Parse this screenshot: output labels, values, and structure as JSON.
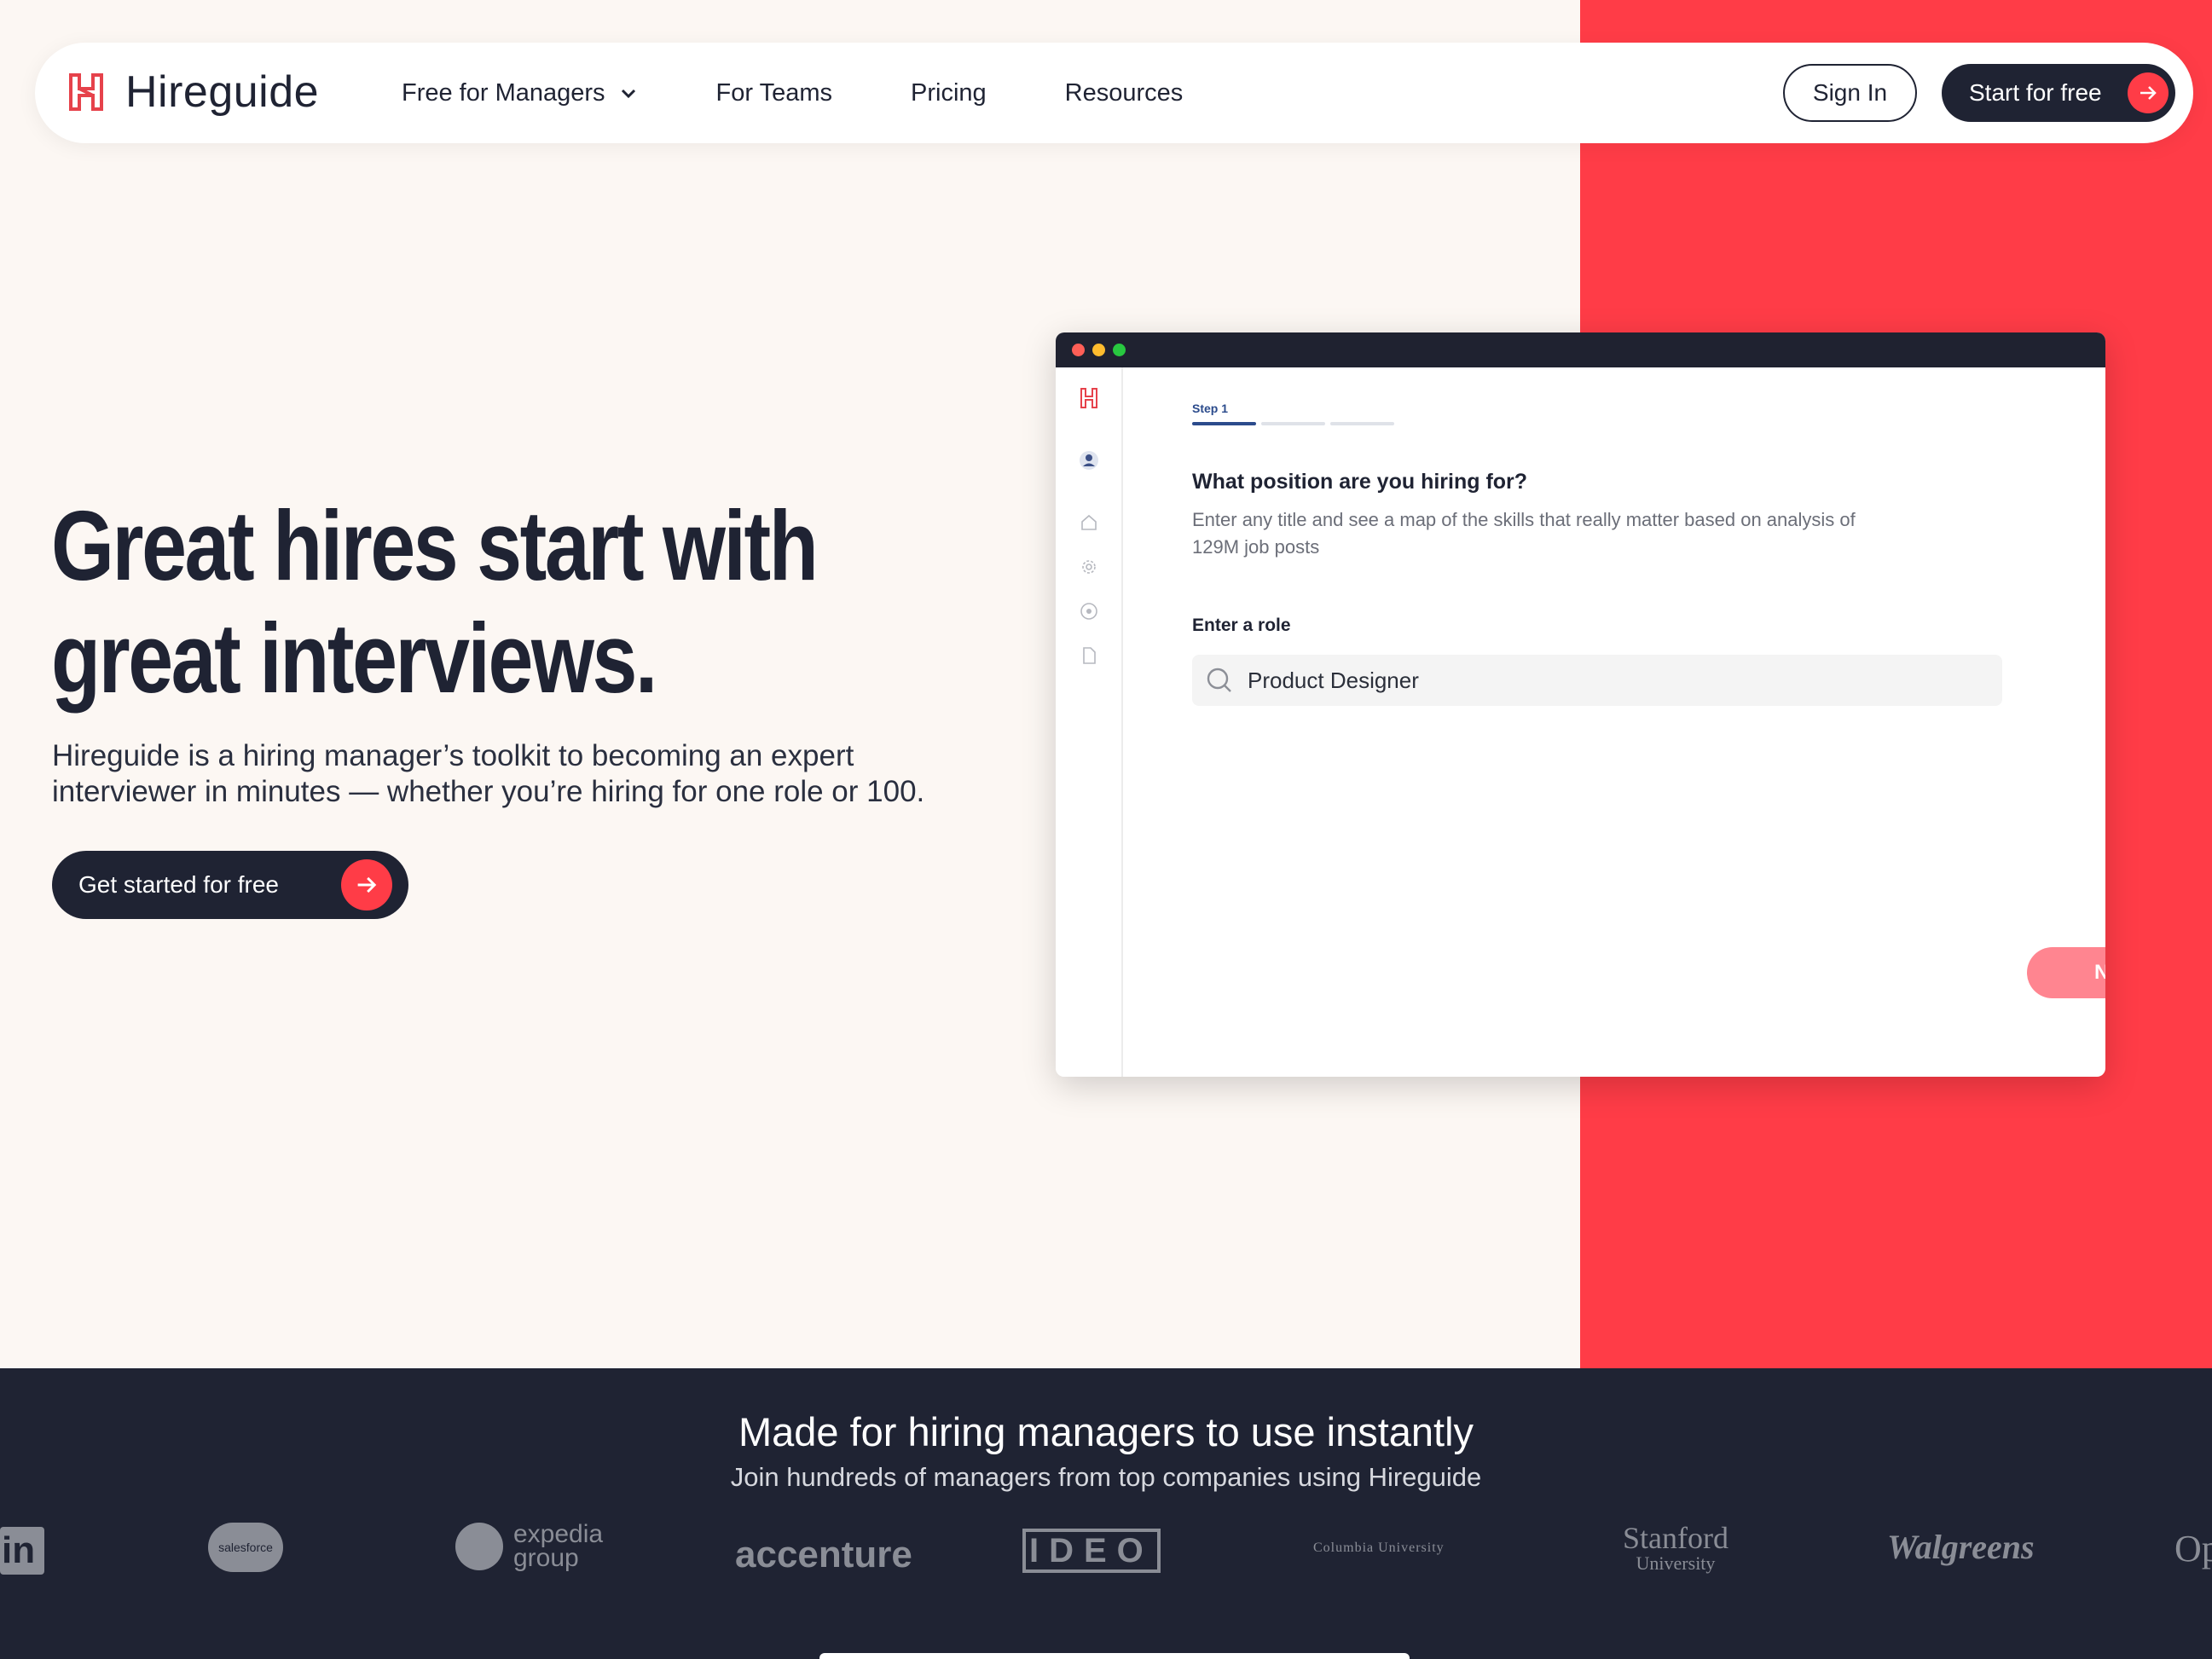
{
  "brand": {
    "name": "Hireguide",
    "accent_color": "#ff3c47",
    "dark_color": "#1f2333",
    "bg_color": "#fcf7f3"
  },
  "nav": {
    "links": [
      {
        "label": "Free for Managers",
        "has_dropdown": true
      },
      {
        "label": "For Teams"
      },
      {
        "label": "Pricing"
      },
      {
        "label": "Resources"
      }
    ],
    "signin_label": "Sign In",
    "start_label": "Start for free"
  },
  "hero": {
    "title_line1": "Great hires start with",
    "title_line2": "great interviews.",
    "subtitle": "Hireguide is a hiring manager’s toolkit to becoming an expert interviewer in minutes — whether you’re hiring for one role or 100.",
    "cta_label": "Get started for free"
  },
  "mock": {
    "step_label": "Step 1",
    "question": "What position are you hiring for?",
    "description": "Enter any title and see a map of the skills that really matter based on analysis of 129M job posts",
    "role_label": "Enter a role",
    "role_value": "Product Designer",
    "next_label": "Next"
  },
  "trust": {
    "title": "Made for hiring managers to use instantly",
    "subtitle": "Join hundreds of managers from top companies using Hireguide",
    "logos": [
      "in",
      "salesforce",
      "expedia",
      "group",
      "accenture",
      "IDEO",
      "Columbia University",
      "Stanford",
      "University",
      "Walgreens",
      "Op"
    ]
  }
}
